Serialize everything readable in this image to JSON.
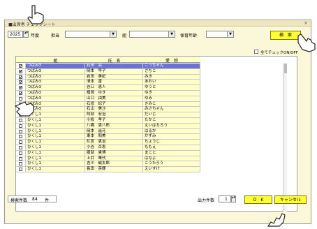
{
  "window": {
    "title": "■出席者 チェックシート",
    "close": "×"
  },
  "filters": {
    "year": "2025",
    "year_label": "年度",
    "teacher_label": "担当",
    "teacher_value": "",
    "class_label": "組",
    "class_value": "",
    "age_label": "保育年齢",
    "age_value": ""
  },
  "buttons": {
    "search": "検　索",
    "ok": "O　K",
    "cancel": "キャンセル",
    "check_all_label": "全てチェックON/OFF"
  },
  "grid": {
    "headers": [
      "組",
      "氏　名",
      "愛　称"
    ],
    "rows": [
      {
        "checked": true,
        "selected": true,
        "cls": "つばみ3",
        "name": "石田　亮",
        "nick": "こうちゃん"
      },
      {
        "checked": true,
        "selected": false,
        "cls": "つばみ3",
        "name": "岡本　早子",
        "nick": "さちこ"
      },
      {
        "checked": true,
        "selected": false,
        "cls": "つばみ3",
        "name": "岩田　美紀",
        "nick": "みき"
      },
      {
        "checked": true,
        "selected": false,
        "cls": "つばみ3",
        "name": "清本　香",
        "nick": "あおい"
      },
      {
        "checked": true,
        "selected": false,
        "cls": "つばみ3",
        "name": "谷口　恵人",
        "nick": "ゆうと"
      },
      {
        "checked": true,
        "selected": false,
        "cls": "つばみ3",
        "name": "植岡　ゆき",
        "nick": "ゆき"
      },
      {
        "checked": false,
        "selected": false,
        "cls": "つばみ3",
        "name": "山口　由美",
        "nick": "ゆみ"
      },
      {
        "checked": false,
        "selected": false,
        "cls": "つばみ3",
        "name": "石垣　紀子",
        "nick": "きみこ"
      },
      {
        "checked": false,
        "selected": false,
        "cls": "つばみ3",
        "name": "石山　美沙",
        "nick": "みさちゃん"
      },
      {
        "checked": false,
        "selected": false,
        "cls": "ひくし1",
        "name": "阿部　宏治",
        "nick": "だいじ"
      },
      {
        "checked": false,
        "selected": false,
        "cls": "ひくし1",
        "name": "小坂　孝子",
        "nick": "たかこ"
      },
      {
        "checked": false,
        "selected": false,
        "cls": "ひくし1",
        "name": "八橋　恵八郎",
        "nick": "えいはちろう"
      },
      {
        "checked": false,
        "selected": false,
        "cls": "ひくし1",
        "name": "岡本　遥花",
        "nick": "はるか"
      },
      {
        "checked": false,
        "selected": false,
        "cls": "ひくし1",
        "name": "東本　和美",
        "nick": "かずみ"
      },
      {
        "checked": false,
        "selected": false,
        "cls": "ひくし1",
        "name": "紅宮　恵治",
        "nick": "ちょうじ"
      },
      {
        "checked": false,
        "selected": false,
        "cls": "ひくし1",
        "name": "小谷　百恵",
        "nick": "ももえ"
      },
      {
        "checked": false,
        "selected": false,
        "cls": "ひくし1",
        "name": "服部　貴博",
        "nick": "まこと"
      },
      {
        "checked": false,
        "selected": false,
        "cls": "ひくし1",
        "name": "上井　華代",
        "nick": "はなよ"
      },
      {
        "checked": false,
        "selected": false,
        "cls": "ひくし1",
        "name": "吉川　誠太郎",
        "nick": "こうたろう"
      },
      {
        "checked": false,
        "selected": false,
        "cls": "ひくし1",
        "name": "長田　英輝",
        "nick": "えいすけ"
      }
    ]
  },
  "footer": {
    "count_label": "検索件数",
    "count_value": "84",
    "count_unit": "件",
    "output_label": "出力件数",
    "output_value": "1"
  },
  "colors": {
    "selected_row": "#6b73d6",
    "cell_yellow": "#ffffcc",
    "button_yellow": "#ffff33",
    "window_bg": "#fbf7d9"
  }
}
